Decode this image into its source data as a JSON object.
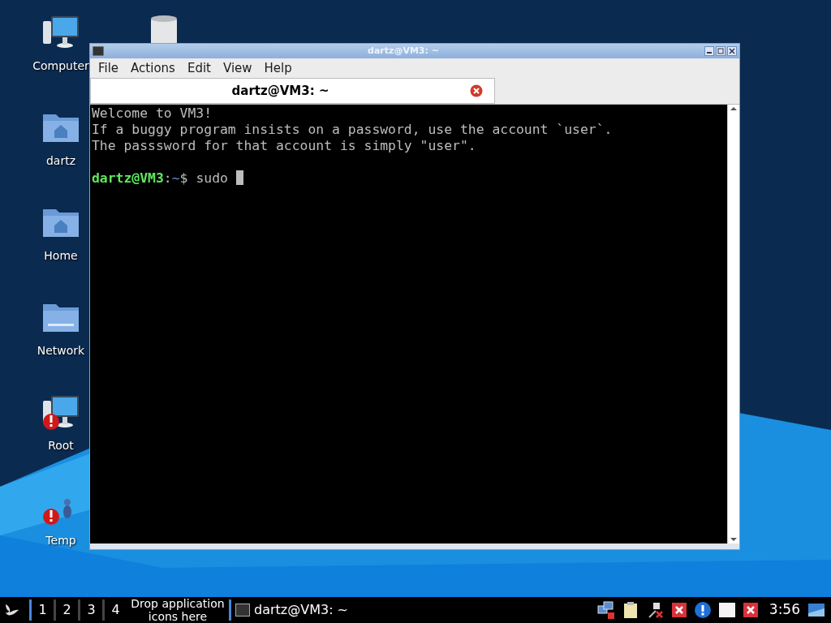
{
  "desktop_icons": [
    {
      "kind": "computer",
      "label": "Computer"
    },
    {
      "kind": "trash"
    },
    {
      "kind": "home-folder",
      "label": "dartz"
    },
    {
      "kind": "home-folder",
      "label": "Home"
    },
    {
      "kind": "network-folder",
      "label": "Network"
    },
    {
      "kind": "root",
      "label": "Root"
    },
    {
      "kind": "temp",
      "label": "Temp"
    }
  ],
  "window": {
    "title": "dartz@VM3: ~",
    "menu": [
      "File",
      "Actions",
      "Edit",
      "View",
      "Help"
    ],
    "tabs": [
      {
        "label": "dartz@VM3: ~",
        "selected": true
      }
    ],
    "terminal": {
      "lines": [
        {
          "kind": "text",
          "text": "Welcome to VM3!"
        },
        {
          "kind": "text",
          "text": "If a buggy program insists on a password, use the account `user`."
        },
        {
          "kind": "text",
          "text": "The passsword for that account is simply \"user\"."
        },
        {
          "kind": "blank"
        },
        {
          "kind": "prompt",
          "user": "dartz@VM3",
          "separator": ":",
          "path": "~",
          "symbol": "$",
          "command": "sudo"
        }
      ]
    }
  },
  "taskbar": {
    "workspaces": [
      "1",
      "2",
      "3",
      "4"
    ],
    "launcher_hint": "Drop application icons here",
    "tasks": [
      {
        "label": "dartz@VM3: ~"
      }
    ],
    "tray": [
      {
        "kind": "network"
      },
      {
        "kind": "clipboard"
      },
      {
        "kind": "plug"
      },
      {
        "kind": "error"
      },
      {
        "kind": "info"
      },
      {
        "kind": "blank"
      },
      {
        "kind": "error"
      }
    ],
    "clock": "3:56"
  }
}
